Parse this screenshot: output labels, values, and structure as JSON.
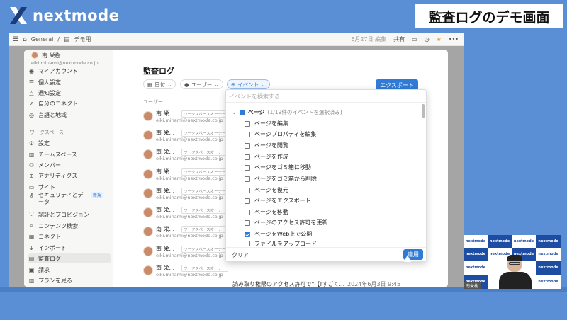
{
  "brand": {
    "name": "nextmode"
  },
  "slide_title": "監査ログのデモ画面",
  "appbar": {
    "breadcrumb1": "General",
    "breadcrumb_sep": "/",
    "breadcrumb2": "デモ用",
    "edited": "6月27日 編集",
    "share": "共有"
  },
  "sidebar": {
    "user_name": "南 栄樹",
    "user_email": "eiki.minami@nextmode.co.jp",
    "account_items": [
      {
        "label": "マイアカウント",
        "icon": "person-icon"
      },
      {
        "label": "個人設定",
        "icon": "sliders-icon"
      },
      {
        "label": "通知設定",
        "icon": "bell-icon"
      },
      {
        "label": "自分のコネクト",
        "icon": "connect-icon"
      },
      {
        "label": "言語と地域",
        "icon": "globe-icon"
      }
    ],
    "workspace_heading": "ワークスペース",
    "workspace_items": [
      {
        "label": "設定",
        "icon": "gear-icon"
      },
      {
        "label": "チームスペース",
        "icon": "building-icon"
      },
      {
        "label": "メンバー",
        "icon": "people-icon"
      },
      {
        "label": "アナリティクス",
        "icon": "analytics-icon"
      },
      {
        "label": "サイト",
        "icon": "site-icon"
      },
      {
        "label": "セキュリティとデータ",
        "icon": "key-icon",
        "badge": "新規"
      },
      {
        "label": "認証とプロビジョン",
        "icon": "shield-icon"
      },
      {
        "label": "コンテンツ検索",
        "icon": "search-icon"
      },
      {
        "label": "コネクト",
        "icon": "grid-icon"
      },
      {
        "label": "インポート",
        "icon": "import-icon"
      },
      {
        "label": "監査ログ",
        "icon": "log-icon",
        "active": true
      },
      {
        "label": "請求",
        "icon": "billing-icon"
      },
      {
        "label": "プランを見る",
        "icon": "map-icon"
      }
    ]
  },
  "main": {
    "title": "監査ログ",
    "filters": {
      "date": "日付",
      "user": "ユーザー",
      "event": "イベント"
    },
    "export_label": "エクスポート",
    "column_user": "ユーザー",
    "rows": [
      {
        "name": "南 栄...",
        "badge": "ワークスペースオーナー",
        "email": "eiki.minami@nextmode.co.jp"
      },
      {
        "name": "南 栄...",
        "badge": "ワークスペースオーナー",
        "email": "eiki.minami@nextmode.co.jp"
      },
      {
        "name": "南 栄...",
        "badge": "ワークスペースオーナー",
        "email": "eiki.minami@nextmode.co.jp"
      },
      {
        "name": "南 栄...",
        "badge": "ワークスペースオーナー",
        "email": "eiki.minami@nextmode.co.jp"
      },
      {
        "name": "南 栄...",
        "badge": "ワークスペースオーナー",
        "email": "eiki.minami@nextmode.co.jp"
      },
      {
        "name": "南 栄...",
        "badge": "ワークスペースオーナー",
        "email": "eiki.minami@nextmode.co.jp"
      },
      {
        "name": "南 栄...",
        "badge": "ワークスペースオーナー",
        "email": "eiki.minami@nextmode.co.jp"
      },
      {
        "name": "南 栄...",
        "badge": "ワークスペースオーナー",
        "email": "eiki.minami@nextmode.co.jp"
      },
      {
        "name": "南 栄...",
        "badge": "ワークスペースオーナー",
        "email": "eiki.minami@nextmode.co.jp"
      }
    ],
    "last_row_event": "読み取り権限のアクセス許可で\"【!すごく...",
    "last_row_date": "2024年6月3日 9:45"
  },
  "dropdown": {
    "search_placeholder": "イベントを検索する",
    "group_label": "ページ",
    "group_count": "(1/19件のイベントを選択済み)",
    "items": [
      {
        "label": "ページを編集",
        "checked": false
      },
      {
        "label": "ページプロパティを編集",
        "checked": false
      },
      {
        "label": "ページを閲覧",
        "checked": false
      },
      {
        "label": "ページを作成",
        "checked": false
      },
      {
        "label": "ページをゴミ箱に移動",
        "checked": false
      },
      {
        "label": "ページをゴミ箱から削除",
        "checked": false
      },
      {
        "label": "ページを復元",
        "checked": false
      },
      {
        "label": "ページをエクスポート",
        "checked": false
      },
      {
        "label": "ページを移動",
        "checked": false
      },
      {
        "label": "ページのアクセス許可を更新",
        "checked": false
      },
      {
        "label": "ページをWeb上で公開",
        "checked": true
      },
      {
        "label": "ファイルをアップロード",
        "checked": false
      }
    ],
    "clear_label": "クリア",
    "apply_label": "適用"
  },
  "video": {
    "name_tag": "南栄樹",
    "tile_text": "nextmode"
  }
}
